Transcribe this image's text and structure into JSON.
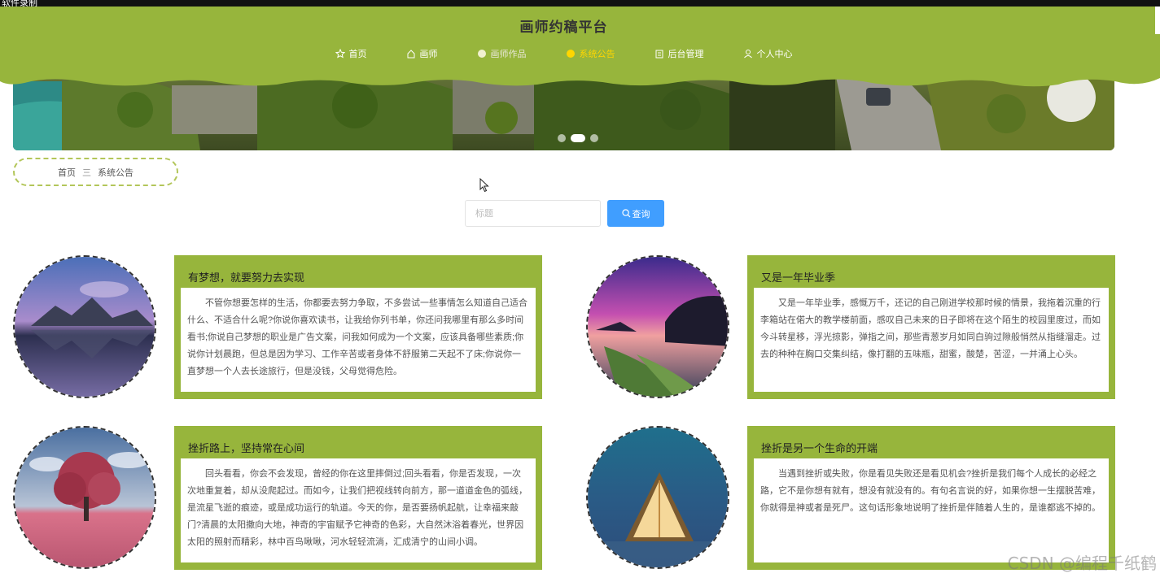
{
  "recording_label": "软件录制",
  "site_title": "画师约稿平台",
  "nav": [
    {
      "label": "首页",
      "icon": "star-icon",
      "active": false
    },
    {
      "label": "画师",
      "icon": "home-icon",
      "active": false
    },
    {
      "label": "画师作品",
      "icon": "circle-icon",
      "active": false
    },
    {
      "label": "系统公告",
      "icon": "circle-icon",
      "active": true
    },
    {
      "label": "后台管理",
      "icon": "building-icon",
      "active": false
    },
    {
      "label": "个人中心",
      "icon": "user-icon",
      "active": false
    }
  ],
  "breadcrumb": {
    "home": "首页",
    "separator": "三",
    "current": "系统公告"
  },
  "search": {
    "placeholder": "标题",
    "value": "",
    "button_label": "查询"
  },
  "announcements": [
    {
      "title": "有梦想，就要努力去实现",
      "content": "不管你想要怎样的生活，你都要去努力争取，不多尝试一些事情怎么知道自己适合什么、不适合什么呢?你说你喜欢读书，让我给你列书单，你还问我哪里有那么多时间看书;你说自己梦想的职业是广告文案，问我如何成为一个文案，应该具备哪些素质;你说你计划晨跑，但总是因为学习、工作辛苦或者身体不舒服第二天起不了床;你说你一直梦想一个人去长途旅行，但是没钱，父母觉得危险。"
    },
    {
      "title": "又是一年毕业季",
      "content": "又是一年毕业季，感慨万千，还记的自己刚进学校那时候的情景，我拖着沉重的行李箱站在偌大的教学楼前面，感叹自己未来的日子即将在这个陌生的校园里度过，而如今斗转星移，浮光掠影，弹指之间，那些青葱岁月如同白驹过隙般悄然从指缝溜走。过去的种种在胸口交集纠结，像打翻的五味瓶，甜蜜，酸楚，苦涩，一并涌上心头。"
    },
    {
      "title": "挫折路上，坚持常在心间",
      "content": "回头看看，你会不会发现，曾经的你在这里摔倒过;回头看看，你是否发现，一次次地重复着，却从没爬起过。而如今，让我们把视线转向前方，那一道道金色的弧线，是流星飞逝的痕迹，或是成功运行的轨道。今天的你，是否要扬帆起航，让幸福来敲门?清晨的太阳撒向大地，神奇的宇宙赋予它神奇的色彩，大自然沐浴着春光，世界因太阳的照射而精彩，林中百鸟啾啾，河水轻轻流淌，汇成清宁的山间小调。"
    },
    {
      "title": "挫折是另一个生命的开端",
      "content": "当遇到挫折或失败，你是看见失败还是看见机会?挫折是我们每个人成长的必经之路，它不是你想有就有，想没有就没有的。有句名言说的好，如果你想一生摆脱苦难，你就得是神或者是死尸。这句话形象地说明了挫折是伴随着人生的，是谁都逃不掉的。"
    }
  ],
  "watermark": "CSDN @编程千纸鹤",
  "colors": {
    "header_green": "#97b53c",
    "active_nav": "#ffd600",
    "button_blue": "#409eff",
    "card_green": "#97b53c"
  }
}
